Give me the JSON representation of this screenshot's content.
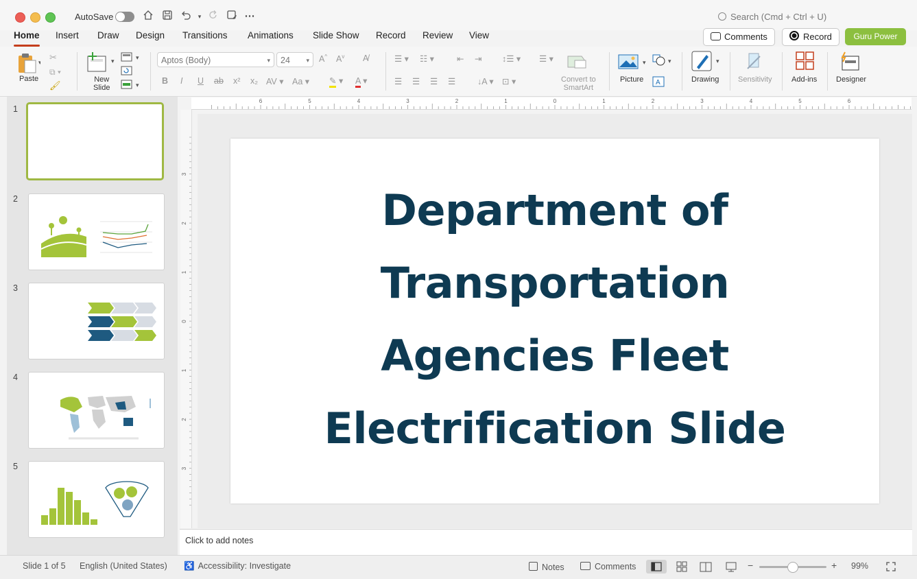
{
  "titlebar": {
    "autosave_label": "AutoSave",
    "search_placeholder": "Search (Cmd + Ctrl + U)"
  },
  "tabs": [
    {
      "label": "Home"
    },
    {
      "label": "Insert"
    },
    {
      "label": "Draw"
    },
    {
      "label": "Design"
    },
    {
      "label": "Transitions"
    },
    {
      "label": "Animations"
    },
    {
      "label": "Slide Show"
    },
    {
      "label": "Record"
    },
    {
      "label": "Review"
    },
    {
      "label": "View"
    }
  ],
  "header_buttons": {
    "comments": "Comments",
    "record": "Record",
    "guru": "Guru Power"
  },
  "ribbon": {
    "paste": "Paste",
    "new_slide_line1": "New",
    "new_slide_line2": "Slide",
    "font_name": "Aptos (Body)",
    "font_size": "24",
    "convert_line1": "Convert to",
    "convert_line2": "SmartArt",
    "picture": "Picture",
    "drawing": "Drawing",
    "sensitivity": "Sensitivity",
    "addins": "Add-ins",
    "designer": "Designer"
  },
  "thumbnails": [
    {
      "number": "1"
    },
    {
      "number": "2"
    },
    {
      "number": "3"
    },
    {
      "number": "4"
    },
    {
      "number": "5"
    }
  ],
  "ruler": {
    "h_ticks": [
      "6",
      "5",
      "4",
      "3",
      "2",
      "1",
      "0",
      "1",
      "2",
      "3",
      "4",
      "5",
      "6"
    ],
    "v_ticks": [
      "3",
      "2",
      "1",
      "0",
      "1",
      "2",
      "3"
    ]
  },
  "slide": {
    "title_lines": [
      "Department of",
      "Transportation",
      "Agencies Fleet",
      "Electrification Slide"
    ]
  },
  "notes": {
    "placeholder": "Click to add notes"
  },
  "status": {
    "slide_count": "Slide 1 of 5",
    "language": "English (United States)",
    "accessibility": "Accessibility: Investigate",
    "notes": "Notes",
    "comments": "Comments",
    "zoom": "99%"
  },
  "colors": {
    "accent_tab": "#c43e1c",
    "guru_green": "#8cbf3f",
    "title_navy": "#0e3a52",
    "selected_thumb": "#9fb843"
  }
}
